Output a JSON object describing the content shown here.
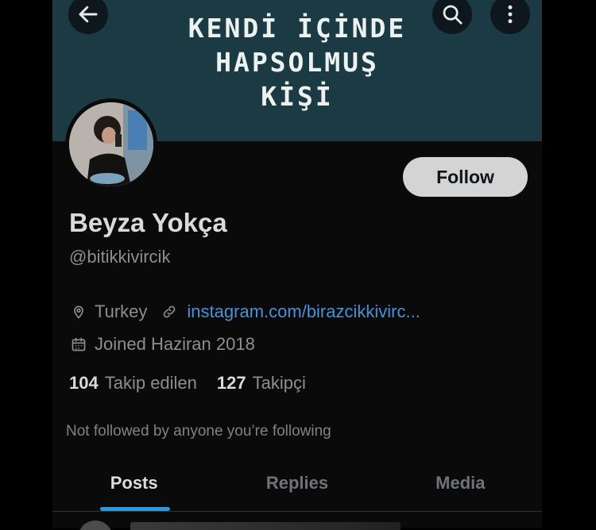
{
  "banner": {
    "lines": [
      "KENDİ İÇİNDE",
      "HAPSOLMUŞ",
      "KİŞİ"
    ],
    "background": "#1b3a44"
  },
  "topbar": {
    "back_icon": "arrow-left-icon",
    "search_icon": "search-icon",
    "more_icon": "more-vertical-icon"
  },
  "profile": {
    "name": "Beyza Yokça",
    "handle": "@bitikkivircik",
    "follow_label": "Follow",
    "location": "Turkey",
    "link": "instagram.com/birazcikkivirc...",
    "joined": "Joined Haziran 2018",
    "following_count": "104",
    "following_label": "Takip edilen",
    "followers_count": "127",
    "followers_label": "Takipçi",
    "not_followed": "Not followed by anyone you’re following"
  },
  "tabs": [
    {
      "label": "Posts",
      "active": true
    },
    {
      "label": "Replies",
      "active": false
    },
    {
      "label": "Media",
      "active": false
    }
  ],
  "colors": {
    "accent": "#1d9bf0",
    "link": "#4a90d9"
  }
}
